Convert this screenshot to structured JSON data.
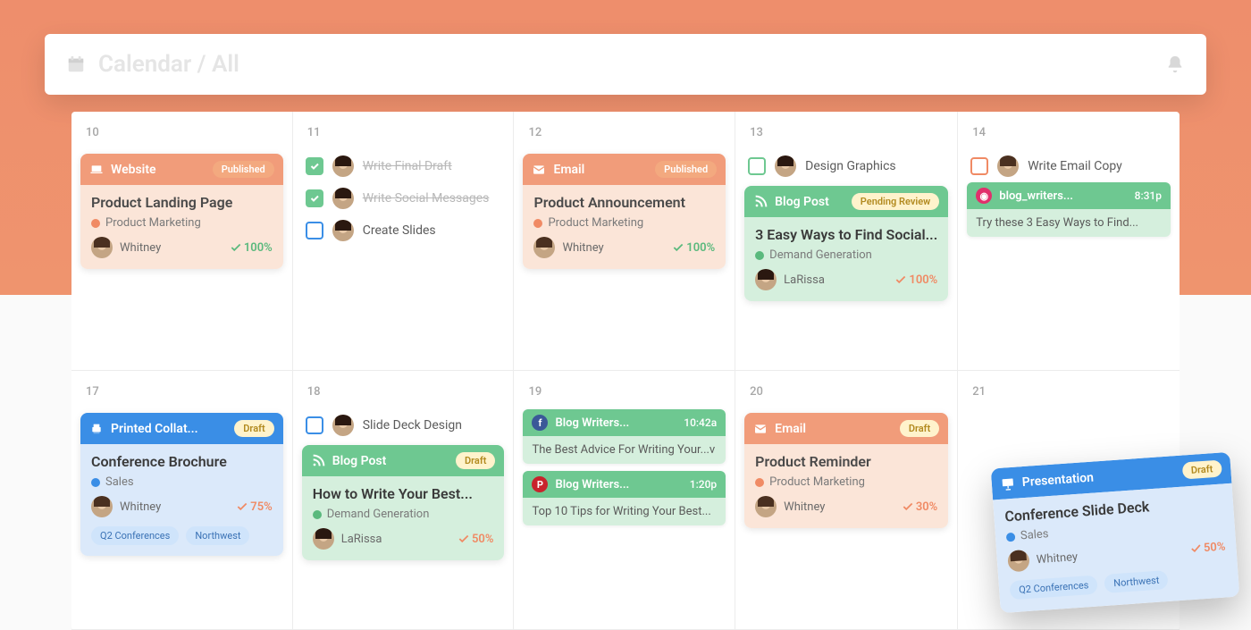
{
  "header": {
    "title": "Calendar / All"
  },
  "colors": {
    "orange": "#f08a64",
    "green": "#6ec891",
    "blue": "#3a8ee6"
  },
  "days_row1": [
    "10",
    "11",
    "12",
    "13",
    "14"
  ],
  "days_row2": [
    "17",
    "18",
    "19",
    "20",
    "21"
  ],
  "d10_card": {
    "type": "Website",
    "status": "Published",
    "title": "Product Landing Page",
    "tag": "Product Marketing",
    "owner": "Whitney",
    "progress": "100%"
  },
  "d11_tasks": [
    {
      "label": "Write Final Draft",
      "done": true
    },
    {
      "label": "Write Social Messages",
      "done": true
    },
    {
      "label": "Create Slides",
      "done": false,
      "box": "blue"
    }
  ],
  "d12_card": {
    "type": "Email",
    "status": "Published",
    "title": "Product Announcement",
    "tag": "Product Marketing",
    "owner": "Whitney",
    "progress": "100%"
  },
  "d13_task": {
    "label": "Design Graphics",
    "box": "green2"
  },
  "d13_card": {
    "type": "Blog Post",
    "status": "Pending Review",
    "title": "3 Easy Ways to Find Social...",
    "tag": "Demand Generation",
    "owner": "LaRissa",
    "progress": "100%"
  },
  "d14_task": {
    "label": "Write Email Copy",
    "box": "orange"
  },
  "d14_social": {
    "network": "ig",
    "account": "blog_writers...",
    "time": "8:31p",
    "text": "Try these 3 Easy Ways to Find..."
  },
  "d17_card": {
    "type": "Printed Collat...",
    "status": "Draft",
    "title": "Conference Brochure",
    "tag": "Sales",
    "owner": "Whitney",
    "progress": "75%",
    "chips": [
      "Q2 Conferences",
      "Northwest"
    ]
  },
  "d18_task": {
    "label": "Slide Deck Design",
    "box": "blue"
  },
  "d18_card": {
    "type": "Blog Post",
    "status": "Draft",
    "title": "How to Write Your Best...",
    "tag": "Demand Generation",
    "owner": "LaRissa",
    "progress": "50%"
  },
  "d19_socials": [
    {
      "network": "fb",
      "account": "Blog Writers...",
      "time": "10:42a",
      "text": "The Best Advice For Writing Your...v"
    },
    {
      "network": "pn",
      "account": "Blog Writers...",
      "time": "1:20p",
      "text": "Top 10 Tips for Writing Your Best..."
    }
  ],
  "d20_card": {
    "type": "Email",
    "status": "Draft",
    "title": "Product Reminder",
    "tag": "Product Marketing",
    "owner": "Whitney",
    "progress": "30%"
  },
  "floating_card": {
    "type": "Presentation",
    "status": "Draft",
    "title": "Conference Slide Deck",
    "tag": "Sales",
    "owner": "Whitney",
    "progress": "50%",
    "chips": [
      "Q2 Conferences",
      "Northwest"
    ]
  }
}
